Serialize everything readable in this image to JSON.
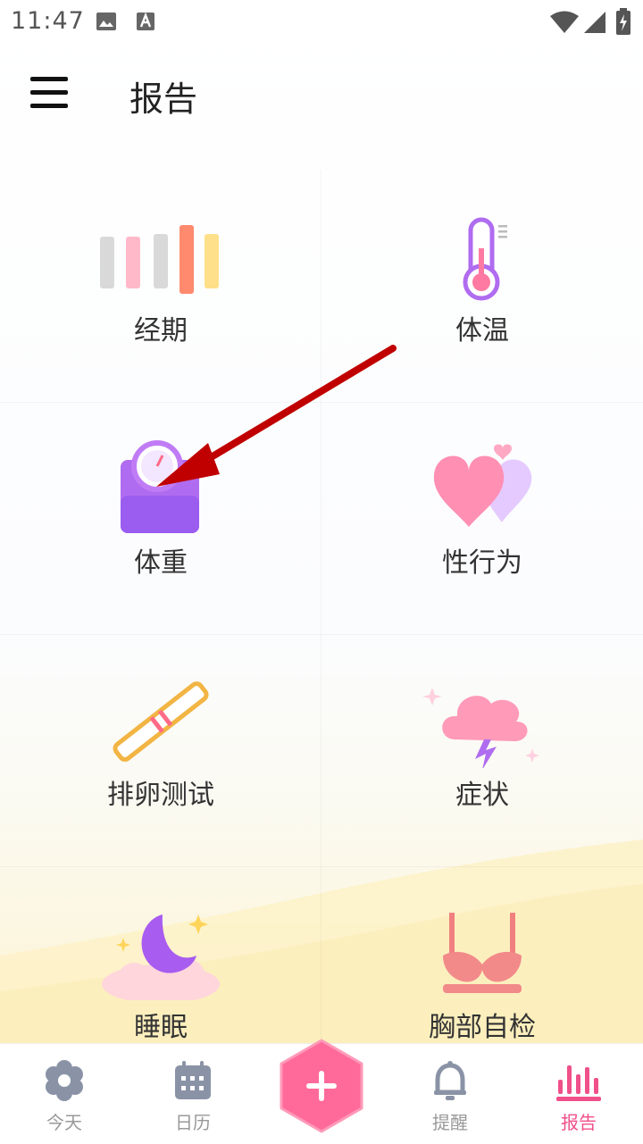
{
  "status_bar": {
    "time": "11:47"
  },
  "app_bar": {
    "title": "报告"
  },
  "grid": {
    "items": [
      {
        "label": "经期"
      },
      {
        "label": "体温"
      },
      {
        "label": "体重"
      },
      {
        "label": "性行为"
      },
      {
        "label": "排卵测试"
      },
      {
        "label": "症状"
      },
      {
        "label": "睡眠"
      },
      {
        "label": "胸部自检"
      }
    ]
  },
  "bottom_nav": {
    "tabs": [
      {
        "label": "今天",
        "icon": "gear-flower-icon"
      },
      {
        "label": "日历",
        "icon": "calendar-icon"
      },
      {
        "label": "提醒",
        "icon": "bell-icon"
      },
      {
        "label": "报告",
        "icon": "bar-chart-icon"
      }
    ],
    "active_color": "#f0508a",
    "fab_icon": "plus-icon"
  }
}
